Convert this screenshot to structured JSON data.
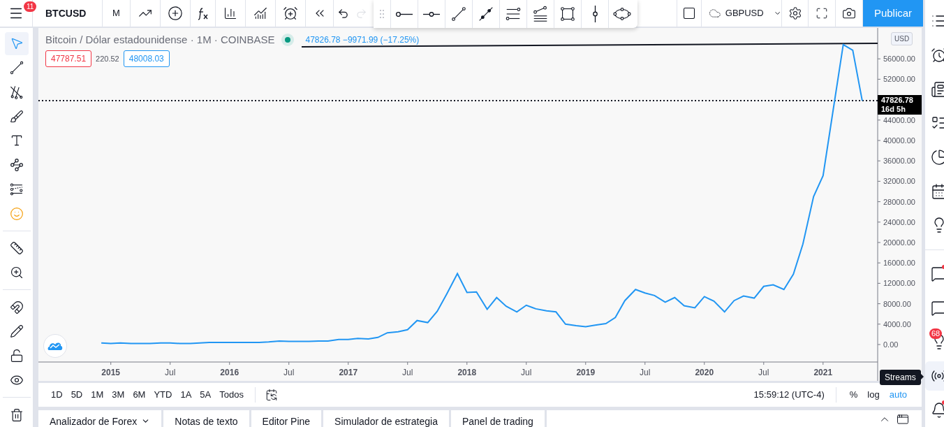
{
  "top_bar": {
    "menu_badge": "11",
    "symbol": "BTCUSD",
    "interval": "M",
    "history": [
      {
        "disabled": false
      },
      {
        "disabled": true
      }
    ],
    "compare_symbol": "GBPUSD",
    "publish": "Publicar"
  },
  "left_toolbar": {
    "tools": [
      {
        "selected": true
      },
      {
        "selected": false
      },
      {
        "selected": false
      },
      {
        "selected": false
      },
      {
        "selected": false
      },
      {
        "selected": false
      },
      {
        "selected": false
      },
      {
        "selected": false
      },
      {
        "selected": false
      },
      {
        "selected": false
      },
      {
        "selected": false
      },
      {
        "selected": false
      },
      {
        "selected": false
      },
      {
        "selected": false
      },
      {
        "selected": false
      }
    ]
  },
  "chart": {
    "legend": {
      "title": "Bitcoin / Dólar estadounidense · 1M · COINBASE",
      "market_open": true,
      "change": "47826.78 −9971.99 (−17.25%)",
      "bid": "47787.51",
      "spread": "220.52",
      "ask": "48008.03"
    },
    "currency": "USD",
    "last_price": "47826.78",
    "countdown": "16d 5h",
    "chart_data": {
      "type": "line",
      "x": [
        2014.92,
        2015.0,
        2015.08,
        2015.17,
        2015.25,
        2015.33,
        2015.42,
        2015.5,
        2015.58,
        2015.67,
        2015.75,
        2015.83,
        2015.92,
        2016.0,
        2016.08,
        2016.17,
        2016.25,
        2016.33,
        2016.42,
        2016.5,
        2016.58,
        2016.67,
        2016.75,
        2016.83,
        2016.92,
        2017.0,
        2017.08,
        2017.17,
        2017.25,
        2017.33,
        2017.42,
        2017.5,
        2017.58,
        2017.67,
        2017.75,
        2017.83,
        2017.92,
        2018.0,
        2018.08,
        2018.17,
        2018.25,
        2018.33,
        2018.42,
        2018.5,
        2018.58,
        2018.67,
        2018.75,
        2018.83,
        2018.92,
        2019.0,
        2019.08,
        2019.17,
        2019.25,
        2019.33,
        2019.42,
        2019.5,
        2019.58,
        2019.67,
        2019.75,
        2019.83,
        2019.92,
        2020.0,
        2020.08,
        2020.17,
        2020.25,
        2020.33,
        2020.42,
        2020.5,
        2020.58,
        2020.67,
        2020.75,
        2020.83,
        2020.92,
        2021.0,
        2021.08,
        2021.17,
        2021.25,
        2021.33
      ],
      "series": [
        {
          "color": "#2196f3",
          "values": [
            300,
            200,
            300,
            200,
            200,
            200,
            300,
            300,
            200,
            200,
            300,
            400,
            400,
            400,
            400,
            400,
            400,
            500,
            700,
            600,
            600,
            600,
            700,
            700,
            1000,
            1000,
            1200,
            1100,
            1400,
            2300,
            2500,
            2900,
            4700,
            4300,
            6500,
            9900,
            13900,
            10200,
            10300,
            6900,
            9200,
            7500,
            6400,
            7700,
            7000,
            6600,
            6400,
            4000,
            3700,
            3500,
            3800,
            4100,
            5300,
            8600,
            10800,
            10100,
            9600,
            8300,
            9200,
            7600,
            7200,
            9400,
            8500,
            6400,
            8600,
            9500,
            9100,
            11400,
            11700,
            10800,
            13800,
            19700,
            29000,
            33100,
            45200,
            58800,
            57700,
            47800
          ]
        }
      ],
      "xlim": [
        2014.39,
        2021.46
      ],
      "ylim": [
        -3425,
        62055
      ],
      "xticks": [
        {
          "value": 2015,
          "label": "2015"
        },
        {
          "value": 2015.5,
          "label": "Jul"
        },
        {
          "value": 2016,
          "label": "2016"
        },
        {
          "value": 2016.5,
          "label": "Jul"
        },
        {
          "value": 2017,
          "label": "2017"
        },
        {
          "value": 2017.5,
          "label": "Jul"
        },
        {
          "value": 2018,
          "label": "2018"
        },
        {
          "value": 2018.5,
          "label": "Jul"
        },
        {
          "value": 2019,
          "label": "2019"
        },
        {
          "value": 2019.5,
          "label": "Jul"
        },
        {
          "value": 2020,
          "label": "2020"
        },
        {
          "value": 2020.5,
          "label": "Jul"
        },
        {
          "value": 2021,
          "label": "2021"
        }
      ],
      "ref_lines": [
        {
          "axis": "y",
          "value": 47800
        }
      ],
      "yticks": [
        {
          "value": 0,
          "label": "0.00"
        },
        {
          "value": 4000,
          "label": "4000.00"
        },
        {
          "value": 8000,
          "label": "8000.00"
        },
        {
          "value": 12000,
          "label": "12000.00"
        },
        {
          "value": 16000,
          "label": "16000.00"
        },
        {
          "value": 20000,
          "label": "20000.00"
        },
        {
          "value": 24000,
          "label": "24000.00"
        },
        {
          "value": 28000,
          "label": "28000.00"
        },
        {
          "value": 32000,
          "label": "32000.00"
        },
        {
          "value": 36000,
          "label": "36000.00"
        },
        {
          "value": 40000,
          "label": "40000.00"
        },
        {
          "value": 44000,
          "label": "44000.00"
        },
        {
          "value": 52000,
          "label": "52000.00"
        },
        {
          "value": 56000,
          "label": "56000.00"
        }
      ]
    }
  },
  "range_bar": {
    "ranges": [
      "1D",
      "5D",
      "1M",
      "3M",
      "6M",
      "YTD",
      "1A",
      "5A",
      "Todos"
    ],
    "time": "15:59:12 (UTC-4)",
    "scale_options": [
      {
        "label": "%",
        "selected": false
      },
      {
        "label": "log",
        "selected": false
      },
      {
        "label": "auto",
        "selected": true
      }
    ]
  },
  "bottom_tabs": [
    {
      "label": "Analizador de Forex",
      "dropdown": true
    },
    {
      "label": "Notas de texto",
      "dropdown": false
    },
    {
      "label": "Editor Pine",
      "dropdown": false
    },
    {
      "label": "Simulador de estrategia",
      "dropdown": false
    },
    {
      "label": "Panel de trading",
      "dropdown": false
    }
  ],
  "right_sidebar": {
    "items": [
      {
        "selected": false,
        "dot": false
      },
      {
        "selected": false,
        "dot": false
      },
      {
        "selected": false,
        "dot": false
      },
      {
        "selected": false,
        "dot": false
      },
      {
        "selected": false,
        "dot": false
      },
      {
        "selected": false,
        "dot": false
      },
      {
        "selected": false,
        "dot": false
      },
      {
        "selected": false,
        "dot": true
      },
      {
        "selected": false,
        "dot": false
      },
      {
        "selected": false,
        "dot": false,
        "badge": "68"
      },
      {
        "selected": true,
        "dot": false
      },
      {
        "selected": false,
        "dot": true
      }
    ]
  },
  "tooltip": "Streams"
}
